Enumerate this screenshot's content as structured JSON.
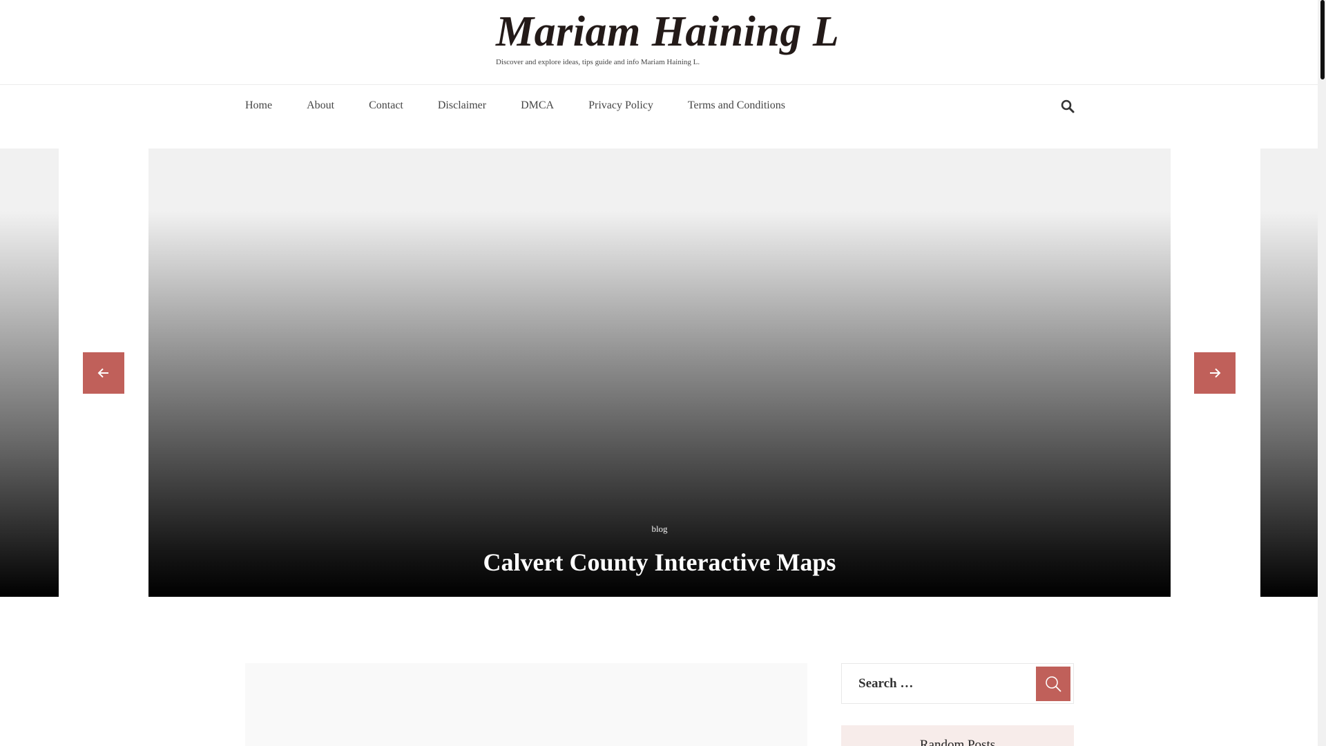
{
  "site": {
    "title": "Mariam Haining L",
    "description": "Discover and explore ideas, tips guide and info Mariam Haining L."
  },
  "nav": {
    "items": [
      {
        "label": "Home"
      },
      {
        "label": "About"
      },
      {
        "label": "Contact"
      },
      {
        "label": "Disclaimer"
      },
      {
        "label": "DMCA"
      },
      {
        "label": "Privacy Policy"
      },
      {
        "label": "Terms and Conditions"
      }
    ],
    "search_icon": "search-icon"
  },
  "slider": {
    "category": "blog",
    "title": "Calvert County Interactive Maps",
    "prev_icon": "arrow-left-icon",
    "next_icon": "arrow-right-icon"
  },
  "sidebar": {
    "search": {
      "placeholder": "Search …",
      "button_icon": "search-icon"
    },
    "random_posts_title": "Random Posts"
  },
  "colors": {
    "accent": "#c0605a",
    "title": "#231a18",
    "widget_bg": "#f7ecea"
  }
}
